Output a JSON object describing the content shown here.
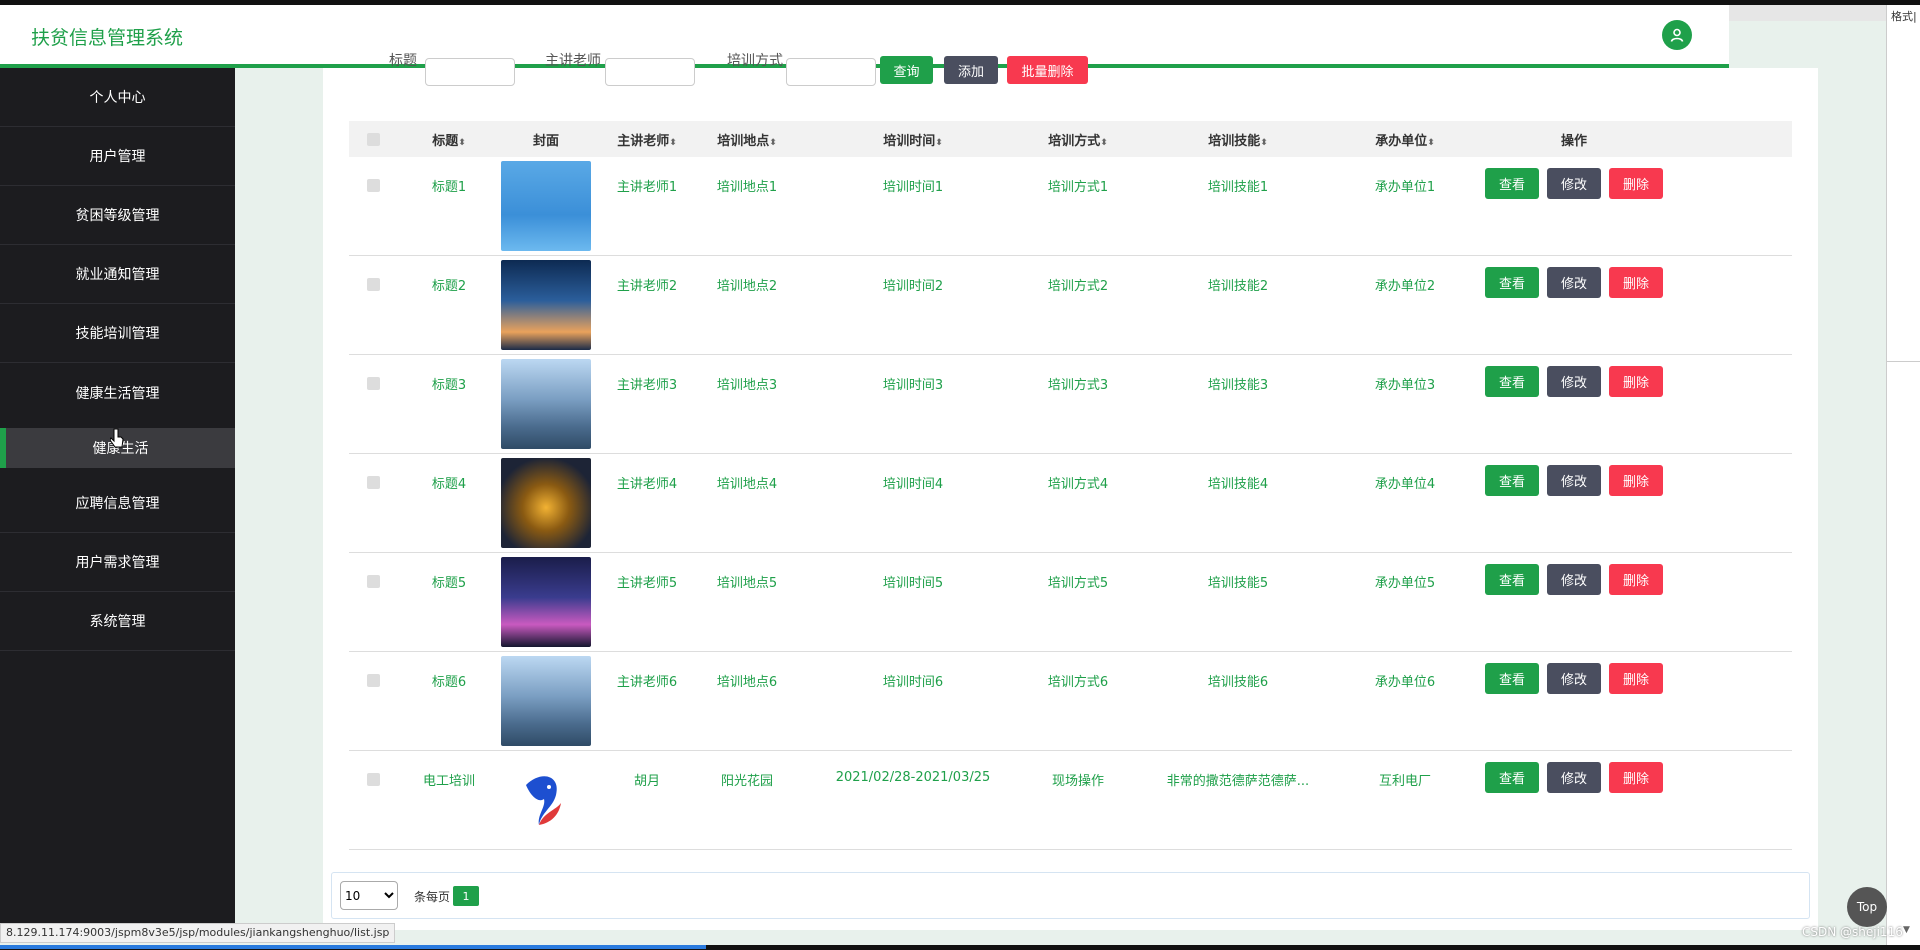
{
  "app": {
    "title": "扶贫信息管理系统"
  },
  "right_panel": {
    "tag": "格式|",
    "arrow": "▼"
  },
  "sidebar": {
    "items": [
      {
        "label": "个人中心"
      },
      {
        "label": "用户管理"
      },
      {
        "label": "贫困等级管理"
      },
      {
        "label": "就业通知管理"
      },
      {
        "label": "技能培训管理"
      },
      {
        "label": "健康生活管理"
      },
      {
        "label": "健康生活",
        "active": true
      },
      {
        "label": "应聘信息管理"
      },
      {
        "label": "用户需求管理"
      },
      {
        "label": "系统管理"
      }
    ]
  },
  "search": {
    "labels": [
      "标题",
      "主讲老师",
      "培训方式"
    ],
    "buttons": {
      "query": "查询",
      "add": "添加",
      "batch_delete": "批量删除"
    }
  },
  "table": {
    "headers": [
      "标题",
      "封面",
      "主讲老师",
      "培训地点",
      "培训时间",
      "培训方式",
      "培训技能",
      "承办单位",
      "操作"
    ],
    "sort_symbol": "⬍",
    "rows": [
      {
        "title": "标题1",
        "teacher": "主讲老师1",
        "place": "培训地点1",
        "time": "培训时间1",
        "mode": "培训方式1",
        "skill": "培训技能1",
        "org": "承办单位1",
        "cover": "weather"
      },
      {
        "title": "标题2",
        "teacher": "主讲老师2",
        "place": "培训地点2",
        "time": "培训时间2",
        "mode": "培训方式2",
        "skill": "培训技能2",
        "org": "承办单位2",
        "cover": "tower"
      },
      {
        "title": "标题3",
        "teacher": "主讲老师3",
        "place": "培训地点3",
        "time": "培训时间3",
        "mode": "培训方式3",
        "skill": "培训技能3",
        "org": "承办单位3",
        "cover": "skyline"
      },
      {
        "title": "标题4",
        "teacher": "主讲老师4",
        "place": "培训地点4",
        "time": "培训时间4",
        "mode": "培训方式4",
        "skill": "培训技能4",
        "org": "承办单位4",
        "cover": "highway"
      },
      {
        "title": "标题5",
        "teacher": "主讲老师5",
        "place": "培训地点5",
        "time": "培训时间5",
        "mode": "培训方式5",
        "skill": "培训技能5",
        "org": "承办单位5",
        "cover": "night-city"
      },
      {
        "title": "标题6",
        "teacher": "主讲老师6",
        "place": "培训地点6",
        "time": "培训时间6",
        "mode": "培训方式6",
        "skill": "培训技能6",
        "org": "承办单位6",
        "cover": "skyline"
      },
      {
        "title": "电工培训",
        "teacher": "胡月",
        "place": "阳光花园",
        "time": "2021/02/28-2021/03/25",
        "mode": "现场操作",
        "skill": "非常的撒范德萨范德萨...",
        "org": "互利电厂",
        "cover": "bird-logo"
      }
    ],
    "actions": {
      "view": "查看",
      "edit": "修改",
      "delete": "删除"
    }
  },
  "pagination": {
    "page_size": "10",
    "page_size_options": [
      "10"
    ],
    "per_page_label": "条每页",
    "current_page": "1"
  },
  "statusbar": {
    "url": "8.129.11.174:9003/jspm8v3e5/jsp/modules/jiankangshenghuo/list.jsp"
  },
  "top_button": "Top",
  "watermark": "CSDN @sheji116",
  "colors": {
    "accent": "#1fa04a",
    "edit": "#4a4e5f",
    "delete": "#f8394f",
    "sidebar": "#1c1c1f"
  }
}
